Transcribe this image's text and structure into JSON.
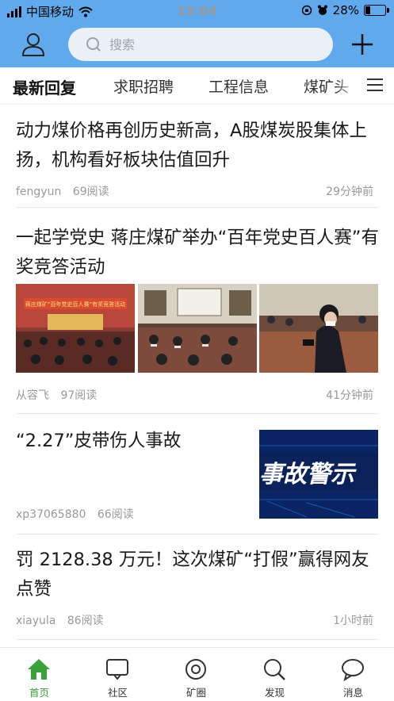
{
  "status_bar": {
    "carrier": "中国移动",
    "time": "15:04",
    "battery": "28%",
    "battery_level": 0.28
  },
  "search": {
    "placeholder": "搜索"
  },
  "tabs": [
    {
      "label": "最新回复",
      "active": true
    },
    {
      "label": "求职招聘"
    },
    {
      "label": "工程信息"
    },
    {
      "label": "煤矿头"
    }
  ],
  "feed": [
    {
      "title": "动力煤价格再创历史新高，A股煤炭股集体上扬，机构看好板块估值回升",
      "author": "fengyun",
      "views": "69阅读",
      "time": "29分钟前"
    },
    {
      "title": "一起学党史 蒋庄煤矿举办“百年党史百人赛”有奖竞答活动",
      "author": "从容飞",
      "views": "97阅读",
      "time": "41分钟前",
      "image_banner_text": "蒋庄煤矿“百年党史百人赛”有奖竞答活动"
    },
    {
      "title": "“2.27”皮带伤人事故",
      "author": "xp37065880",
      "views": "66阅读",
      "thumb_text": "事故警示"
    },
    {
      "title": "罚 2128.38 万元！这次煤矿“打假”赢得网友点赞",
      "author": "xiayula",
      "views": "86阅读",
      "time": "1小时前"
    }
  ],
  "bottom_nav": [
    {
      "label": "首页",
      "icon": "home-icon",
      "active": true
    },
    {
      "label": "社区",
      "icon": "chat-box-icon"
    },
    {
      "label": "矿圈",
      "icon": "circle-icon"
    },
    {
      "label": "发现",
      "icon": "search-icon"
    },
    {
      "label": "消息",
      "icon": "message-bubble-icon"
    }
  ],
  "colors": {
    "header": "#5fa9ec",
    "active_nav": "#3aa23a"
  }
}
